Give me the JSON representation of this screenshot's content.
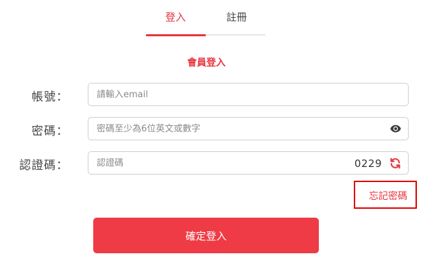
{
  "tabs": {
    "login_label": "登入",
    "register_label": "註冊"
  },
  "form": {
    "title": "會員登入",
    "account": {
      "label": "帳號：",
      "placeholder": "請輸入email",
      "value": ""
    },
    "password": {
      "label": "密碼：",
      "placeholder": "密碼至少為6位英文或數字",
      "value": ""
    },
    "captcha": {
      "label": "認證碼：",
      "placeholder": "認證碼",
      "value": "",
      "code": "0229"
    },
    "forgot_password_label": "忘記密碼",
    "submit_label": "確定登入"
  },
  "colors": {
    "accent": "#e8343f",
    "button": "#ee3b45",
    "highlight_box": "#e00000"
  },
  "icons": {
    "password_toggle": "eye-icon",
    "captcha_refresh": "refresh-icon"
  }
}
